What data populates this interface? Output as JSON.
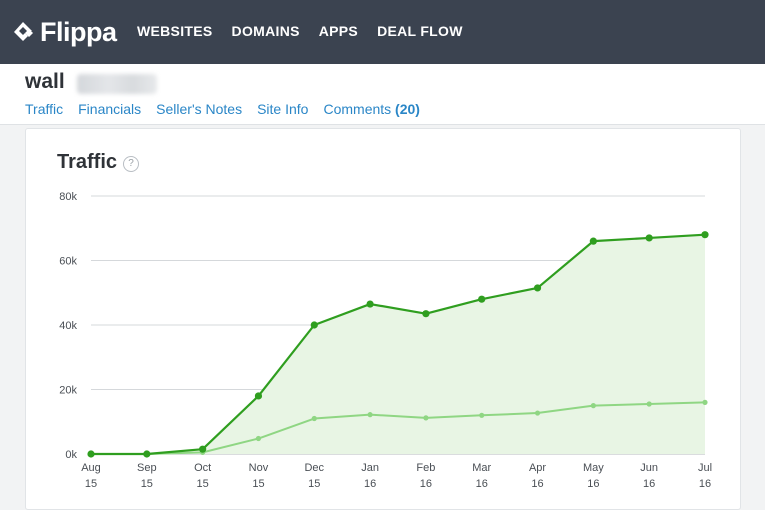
{
  "header": {
    "logo_text": "Flippa",
    "nav": [
      "WEBSITES",
      "DOMAINS",
      "APPS",
      "DEAL FLOW"
    ]
  },
  "listing": {
    "site_name": "wall",
    "tabs": {
      "traffic": "Traffic",
      "financials": "Financials",
      "sellers_notes": "Seller's Notes",
      "site_info": "Site Info",
      "comments": "Comments",
      "comments_count": "(20)"
    }
  },
  "card": {
    "title": "Traffic",
    "help": "?"
  },
  "colors": {
    "topbar": "#3b4350",
    "link": "#2a86c7",
    "series_dark": "#2f9e1f",
    "series_light": "#8fd683",
    "area_fill": "#e8f5e4"
  },
  "chart_data": {
    "type": "area",
    "x": [
      "Aug 15",
      "Sep 15",
      "Oct 15",
      "Nov 15",
      "Dec 15",
      "Jan 16",
      "Feb 16",
      "Mar 16",
      "Apr 16",
      "May 16",
      "Jun 16",
      "Jul 16"
    ],
    "x_tick_lines": [
      [
        "Aug",
        "15"
      ],
      [
        "Sep",
        "15"
      ],
      [
        "Oct",
        "15"
      ],
      [
        "Nov",
        "15"
      ],
      [
        "Dec",
        "15"
      ],
      [
        "Jan",
        "16"
      ],
      [
        "Feb",
        "16"
      ],
      [
        "Mar",
        "16"
      ],
      [
        "Apr",
        "16"
      ],
      [
        "May",
        "16"
      ],
      [
        "Jun",
        "16"
      ],
      [
        "Jul",
        "16"
      ]
    ],
    "y_ticks": [
      "0k",
      "20k",
      "40k",
      "60k",
      "80k"
    ],
    "ylim": [
      0,
      80000
    ],
    "grid": true,
    "series": [
      {
        "values": [
          0,
          0,
          1500,
          18000,
          40000,
          46500,
          43500,
          48000,
          51500,
          66000,
          67000,
          68000
        ]
      },
      {
        "values": [
          0,
          0,
          500,
          4800,
          11000,
          12200,
          11200,
          12000,
          12700,
          15000,
          15500,
          16000
        ]
      }
    ]
  }
}
